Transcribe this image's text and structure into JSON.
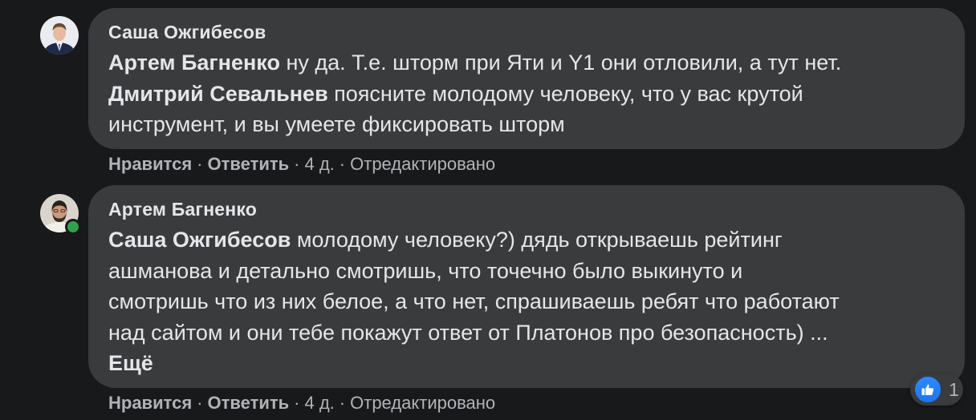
{
  "comments": [
    {
      "author": "Саша Ожгибесов",
      "lines": [
        [
          {
            "mention": "Артем Багненко"
          },
          {
            "text": " ну да. Т.е. шторм при Яти и Y1 они отловили, а тут нет."
          }
        ],
        [
          {
            "mention": "Дмитрий Севальнев"
          },
          {
            "text": " поясните молодому человеку, что у вас крутой"
          }
        ],
        [
          {
            "text": "инструмент, и вы умеете фиксировать шторм"
          }
        ]
      ],
      "actions": {
        "like": "Нравится",
        "reply": "Ответить",
        "time": "4 д.",
        "edited": "Отредактировано"
      }
    },
    {
      "author": "Артем Багненко",
      "lines": [
        [
          {
            "mention": "Саша Ожгибесов"
          },
          {
            "text": " молодому человеку?) дядь открываешь рейтинг"
          }
        ],
        [
          {
            "text": "ашманова и детально смотришь, что точечно было выкинуто и"
          }
        ],
        [
          {
            "text": "смотришь что из них белое, а что нет, спрашиваешь ребят что работают"
          }
        ],
        [
          {
            "text": "над сайтом и они тебе покажут ответ от Платонов про безопасность) ..."
          }
        ]
      ],
      "more": "Ещё",
      "online": true,
      "actions": {
        "like": "Нравится",
        "reply": "Ответить",
        "time": "4 д.",
        "edited": "Отредактировано"
      },
      "reactions": {
        "icon": "like-icon",
        "count": "1",
        "color": "#1877f2"
      }
    }
  ],
  "separator": "·",
  "colors": {
    "background": "#18191a",
    "bubble": "#3a3b3c",
    "text": "#e4e6eb",
    "secondary": "#b0b3b8",
    "online": "#31a24c"
  }
}
